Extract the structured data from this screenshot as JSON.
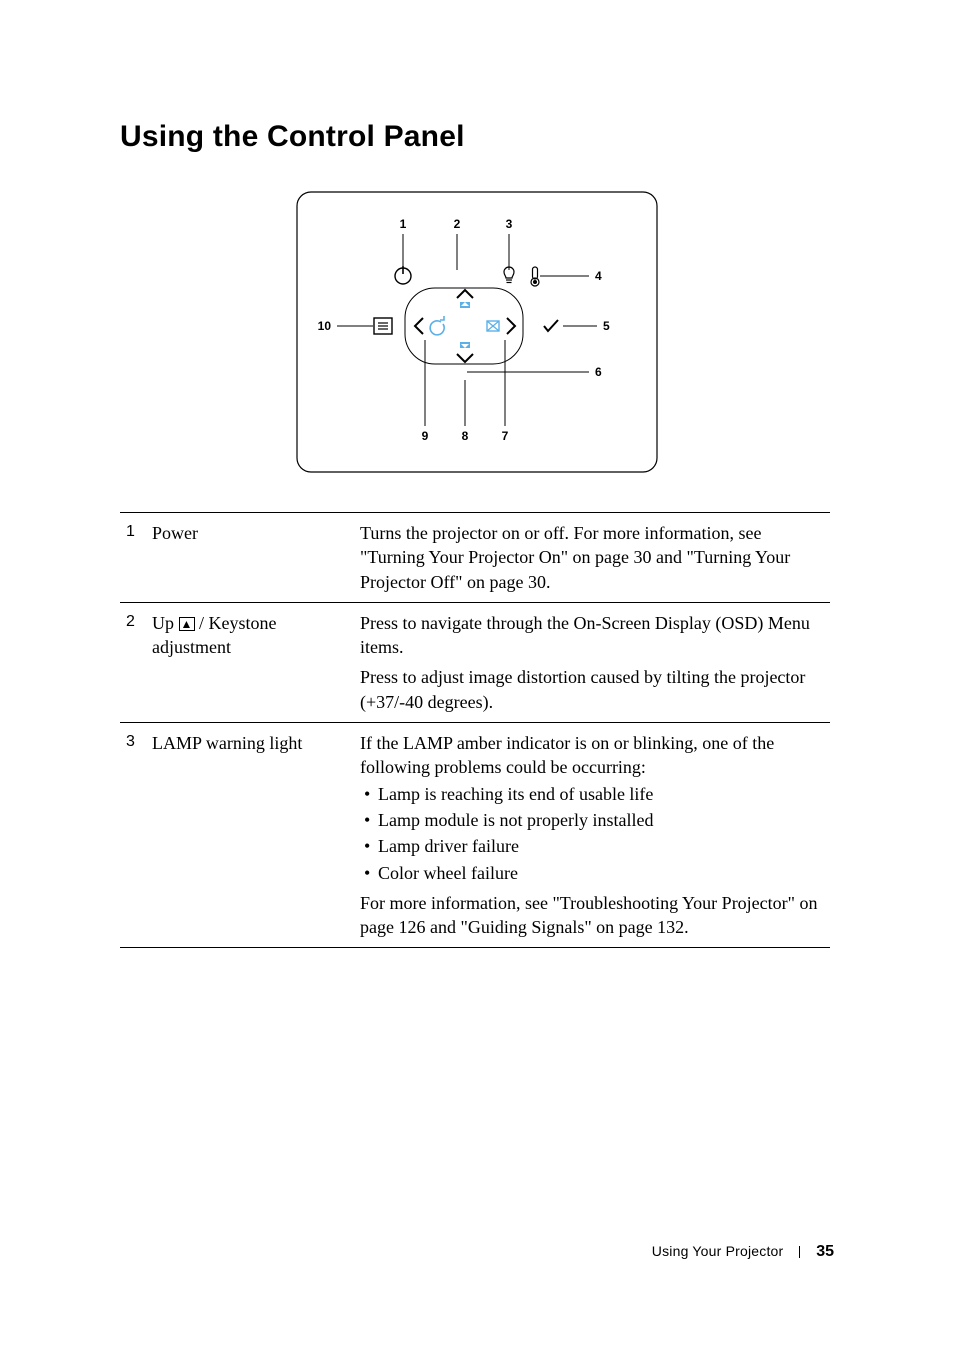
{
  "section_title": "Using the Control Panel",
  "diagram": {
    "callouts": {
      "1": "1",
      "2": "2",
      "3": "3",
      "4": "4",
      "5": "5",
      "6": "6",
      "7": "7",
      "8": "8",
      "9": "9",
      "10": "10"
    }
  },
  "rows": [
    {
      "num": "1",
      "label": "Power",
      "body": "Turns the projector on or off. For more information, see \"Turning Your Projector On\" on page 30 and \"Turning Your Projector Off\" on page 30."
    },
    {
      "num": "2",
      "label_prefix": "Up ",
      "label_suffix": " / Keystone adjustment",
      "body": "Press to navigate through the On-Screen Display (OSD) Menu items.",
      "body2": "Press to adjust image distortion caused by tilting the projector (+37/-40 degrees)."
    },
    {
      "num": "3",
      "label": "LAMP warning light",
      "body": "If the LAMP amber indicator is on or blinking, one of the following problems could be occurring:",
      "bullets": [
        "Lamp is reaching its end of usable life",
        "Lamp module is not properly installed",
        "Lamp driver failure",
        "Color wheel failure"
      ],
      "body3": "For more information, see \"Troubleshooting Your Projector\" on page 126 and \"Guiding Signals\" on page 132."
    }
  ],
  "footer": {
    "label": "Using Your Projector",
    "page": "35"
  }
}
